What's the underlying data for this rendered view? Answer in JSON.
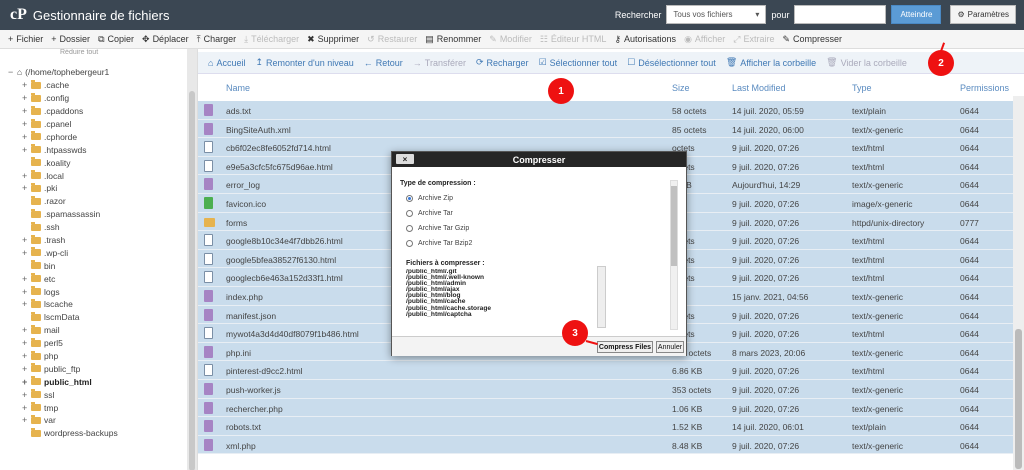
{
  "header": {
    "title": "Gestionnaire de fichiers",
    "search_label": "Rechercher",
    "search_scope": "Tous vos fichiers",
    "pour_label": "pour",
    "search_value": "",
    "go_button": "Atteindre",
    "settings_button": "Paramètres"
  },
  "toolbar": [
    {
      "label": "Fichier",
      "icon": "plus-icon",
      "enabled": true
    },
    {
      "label": "Dossier",
      "icon": "plus-icon",
      "enabled": true
    },
    {
      "label": "Copier",
      "icon": "copy-icon",
      "enabled": true
    },
    {
      "label": "Déplacer",
      "icon": "move-icon",
      "enabled": true
    },
    {
      "label": "Charger",
      "icon": "upload-icon",
      "enabled": true
    },
    {
      "label": "Télécharger",
      "icon": "download-icon",
      "enabled": false
    },
    {
      "label": "Supprimer",
      "icon": "delete-icon",
      "enabled": true
    },
    {
      "label": "Restaurer",
      "icon": "restore-icon",
      "enabled": false
    },
    {
      "label": "Renommer",
      "icon": "rename-icon",
      "enabled": true
    },
    {
      "label": "Modifier",
      "icon": "pencil-icon",
      "enabled": false
    },
    {
      "label": "Éditeur HTML",
      "icon": "html-editor-icon",
      "enabled": false
    },
    {
      "label": "Autorisations",
      "icon": "key-icon",
      "enabled": true
    },
    {
      "label": "Afficher",
      "icon": "eye-icon",
      "enabled": false
    },
    {
      "label": "Extraire",
      "icon": "extract-icon",
      "enabled": false
    },
    {
      "label": "Compresser",
      "icon": "compress-icon",
      "enabled": true
    }
  ],
  "sidebar": {
    "collapse_label": "Réduire tout",
    "tree": [
      {
        "label": "(/home/tophebergeur1",
        "expander": "−",
        "bold": false,
        "home": true
      },
      {
        "label": ".cache",
        "expander": "+"
      },
      {
        "label": ".config",
        "expander": "+"
      },
      {
        "label": ".cpaddons",
        "expander": "+"
      },
      {
        "label": ".cpanel",
        "expander": "+"
      },
      {
        "label": ".cphorde",
        "expander": "+"
      },
      {
        "label": ".htpasswds",
        "expander": "+"
      },
      {
        "label": ".koality",
        "expander": ""
      },
      {
        "label": ".local",
        "expander": "+"
      },
      {
        "label": ".pki",
        "expander": "+"
      },
      {
        "label": ".razor",
        "expander": ""
      },
      {
        "label": ".spamassassin",
        "expander": ""
      },
      {
        "label": ".ssh",
        "expander": ""
      },
      {
        "label": ".trash",
        "expander": "+"
      },
      {
        "label": ".wp-cli",
        "expander": "+"
      },
      {
        "label": "bin",
        "expander": ""
      },
      {
        "label": "etc",
        "expander": "+"
      },
      {
        "label": "logs",
        "expander": "+"
      },
      {
        "label": "lscache",
        "expander": "+"
      },
      {
        "label": "lscmData",
        "expander": ""
      },
      {
        "label": "mail",
        "expander": "+"
      },
      {
        "label": "perl5",
        "expander": "+"
      },
      {
        "label": "php",
        "expander": "+"
      },
      {
        "label": "public_ftp",
        "expander": "+"
      },
      {
        "label": "public_html",
        "expander": "+",
        "bold": true
      },
      {
        "label": "ssl",
        "expander": "+"
      },
      {
        "label": "tmp",
        "expander": "+"
      },
      {
        "label": "var",
        "expander": "+"
      },
      {
        "label": "wordpress-backups",
        "expander": ""
      }
    ]
  },
  "nav": [
    {
      "label": "Accueil",
      "icon": "home-icon",
      "enabled": true
    },
    {
      "label": "Remonter d'un niveau",
      "icon": "level-up-icon",
      "enabled": true
    },
    {
      "label": "Retour",
      "icon": "arrow-left-icon",
      "enabled": true
    },
    {
      "label": "Transférer",
      "icon": "arrow-right-icon",
      "enabled": false
    },
    {
      "label": "Recharger",
      "icon": "reload-icon",
      "enabled": true
    },
    {
      "label": "Sélectionner tout",
      "icon": "checkbox-icon",
      "enabled": true
    },
    {
      "label": "Désélectionner tout",
      "icon": "checkbox-empty-icon",
      "enabled": true
    },
    {
      "label": "Afficher la corbeille",
      "icon": "trash-icon",
      "enabled": true
    },
    {
      "label": "Vider la corbeille",
      "icon": "trash-icon",
      "enabled": false
    }
  ],
  "columns": {
    "name": "Name",
    "size": "Size",
    "modified": "Last Modified",
    "type": "Type",
    "perms": "Permissions"
  },
  "files": [
    {
      "name": "ads.txt",
      "size": "58 octets",
      "modified": "14 juil. 2020, 05:59",
      "type": "text/plain",
      "perms": "0644",
      "kind": "file"
    },
    {
      "name": "BingSiteAuth.xml",
      "size": "85 octets",
      "modified": "14 juil. 2020, 06:00",
      "type": "text/x-generic",
      "perms": "0644",
      "kind": "file"
    },
    {
      "name": "cb6f02ec8fe6052fd714.html",
      "size": "octets",
      "modified": "9 juil. 2020, 07:26",
      "type": "text/html",
      "perms": "0644",
      "kind": "html"
    },
    {
      "name": "e9e5a3cfc5fc675d96ae.html",
      "size": "octets",
      "modified": "9 juil. 2020, 07:26",
      "type": "text/html",
      "perms": "0644",
      "kind": "html"
    },
    {
      "name": "error_log",
      "size": "3 MB",
      "modified": "Aujourd'hui, 14:29",
      "type": "text/x-generic",
      "perms": "0644",
      "kind": "file"
    },
    {
      "name": "favicon.ico",
      "size": "KB",
      "modified": "9 juil. 2020, 07:26",
      "type": "image/x-generic",
      "perms": "0644",
      "kind": "img"
    },
    {
      "name": "forms",
      "size": "KB",
      "modified": "9 juil. 2020, 07:26",
      "type": "httpd/unix-directory",
      "perms": "0777",
      "kind": "dir"
    },
    {
      "name": "google8b10c34e4f7dbb26.html",
      "size": "octets",
      "modified": "9 juil. 2020, 07:26",
      "type": "text/html",
      "perms": "0644",
      "kind": "html"
    },
    {
      "name": "google5bfea38527f6130.html",
      "size": "octets",
      "modified": "9 juil. 2020, 07:26",
      "type": "text/html",
      "perms": "0644",
      "kind": "html"
    },
    {
      "name": "googlecb6e463a152d33f1.html",
      "size": "octets",
      "modified": "9 juil. 2020, 07:26",
      "type": "text/html",
      "perms": "0644",
      "kind": "html"
    },
    {
      "name": "index.php",
      "size": "KB",
      "modified": "15 janv. 2021, 04:56",
      "type": "text/x-generic",
      "perms": "0644",
      "kind": "file"
    },
    {
      "name": "manifest.json",
      "size": "octets",
      "modified": "9 juil. 2020, 07:26",
      "type": "text/x-generic",
      "perms": "0644",
      "kind": "file"
    },
    {
      "name": "mywot4a3d4d40df8079f1b486.html",
      "size": "octets",
      "modified": "9 juil. 2020, 07:26",
      "type": "text/html",
      "perms": "0644",
      "kind": "html"
    },
    {
      "name": "php.ini",
      "size": "635 octets",
      "modified": "8 mars 2023, 20:06",
      "type": "text/x-generic",
      "perms": "0644",
      "kind": "file"
    },
    {
      "name": "pinterest-d9cc2.html",
      "size": "6.86 KB",
      "modified": "9 juil. 2020, 07:26",
      "type": "text/html",
      "perms": "0644",
      "kind": "html"
    },
    {
      "name": "push-worker.js",
      "size": "353 octets",
      "modified": "9 juil. 2020, 07:26",
      "type": "text/x-generic",
      "perms": "0644",
      "kind": "file"
    },
    {
      "name": "rechercher.php",
      "size": "1.06 KB",
      "modified": "9 juil. 2020, 07:26",
      "type": "text/x-generic",
      "perms": "0644",
      "kind": "file"
    },
    {
      "name": "robots.txt",
      "size": "1.52 KB",
      "modified": "14 juil. 2020, 06:01",
      "type": "text/plain",
      "perms": "0644",
      "kind": "file"
    },
    {
      "name": "xml.php",
      "size": "8.48 KB",
      "modified": "9 juil. 2020, 07:26",
      "type": "text/x-generic",
      "perms": "0644",
      "kind": "file"
    }
  ],
  "dialog": {
    "title": "Compresser",
    "close_label": "×",
    "type_label": "Type de compression :",
    "options": [
      {
        "label": "Archive Zip",
        "checked": true
      },
      {
        "label": "Archive Tar",
        "checked": false
      },
      {
        "label": "Archive Tar Gzip",
        "checked": false
      },
      {
        "label": "Archive Tar Bzip2",
        "checked": false
      }
    ],
    "files_label": "Fichiers à compresser :",
    "files": [
      "/public_html/.git",
      "/public_html/.well-known",
      "/public_html/admin",
      "/public_html/ajax",
      "/public_html/blog",
      "/public_html/cache",
      "/public_html/cache.storage",
      "/public_html/captcha"
    ],
    "compress_button": "Compress Files",
    "cancel_button": "Annuler"
  },
  "annotations": [
    "1",
    "2",
    "3"
  ],
  "colors": {
    "header": "#3b4753",
    "selection": "#c9dcec",
    "accent": "#3f78b4",
    "annotation": "#e11111"
  }
}
